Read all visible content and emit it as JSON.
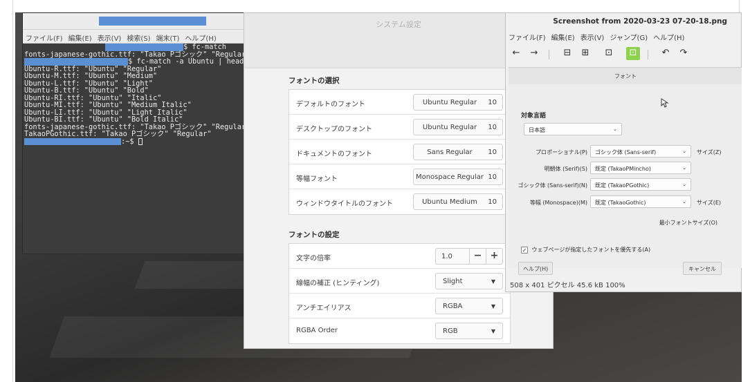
{
  "terminal": {
    "menu": [
      "ファイル(F)",
      "編集(E)",
      "表示(V)",
      "検索(S)",
      "端末(T)",
      "ヘルプ(H)"
    ],
    "window_buttons": [
      "–",
      "⤢",
      "⊗"
    ],
    "lines": [
      {
        "text": "$ fc-match",
        "prompt_width": 150,
        "indent": 117
      },
      {
        "text": "fonts-japanese-gothic.ttf: \"Takao Pゴシック\" \"Regular\"",
        "prompt_width": 0,
        "indent": 0
      },
      {
        "text": "$ fc-match -a Ubuntu | head",
        "prompt_width": 150,
        "indent": 0
      },
      {
        "text": "Ubuntu-R.ttf: \"Ubuntu\" \"Regular\"",
        "prompt_width": 0,
        "indent": 0
      },
      {
        "text": "Ubuntu-M.ttf: \"Ubuntu\" \"Medium\"",
        "prompt_width": 0,
        "indent": 0
      },
      {
        "text": "Ubuntu-L.ttf: \"Ubuntu\" \"Light\"",
        "prompt_width": 0,
        "indent": 0
      },
      {
        "text": "Ubuntu-B.ttf: \"Ubuntu\" \"Bold\"",
        "prompt_width": 0,
        "indent": 0
      },
      {
        "text": "Ubuntu-RI.ttf: \"Ubuntu\" \"Italic\"",
        "prompt_width": 0,
        "indent": 0
      },
      {
        "text": "Ubuntu-MI.ttf: \"Ubuntu\" \"Medium Italic\"",
        "prompt_width": 0,
        "indent": 0
      },
      {
        "text": "Ubuntu-LI.ttf: \"Ubuntu\" \"Light Italic\"",
        "prompt_width": 0,
        "indent": 0
      },
      {
        "text": "Ubuntu-BI.ttf: \"Ubuntu\" \"Bold Italic\"",
        "prompt_width": 0,
        "indent": 0
      },
      {
        "text": "fonts-japanese-gothic.ttf: \"Takao Pゴシック\" \"Regular\"",
        "prompt_width": 0,
        "indent": 0
      },
      {
        "text": "TakaoPGothic.ttf: \"Takao Pゴシック\" \"Regular\"",
        "prompt_width": 0,
        "indent": 0
      },
      {
        "text": ":~$ ",
        "prompt_width": 140,
        "indent": 0,
        "cursor": true
      }
    ]
  },
  "settings": {
    "title": "システム設定",
    "selection": {
      "title": "フォントの選択",
      "rows": [
        {
          "label": "デフォルトのフォント",
          "font": "Ubuntu Regular",
          "size": "10"
        },
        {
          "label": "デスクトップのフォント",
          "font": "Ubuntu Regular",
          "size": "10"
        },
        {
          "label": "ドキュメントのフォント",
          "font": "Sans Regular",
          "size": "10"
        },
        {
          "label": "等幅フォント",
          "font": "Monospace Regular",
          "size": "10"
        },
        {
          "label": "ウィンドウタイトルのフォント",
          "font": "Ubuntu Medium",
          "size": "10"
        }
      ]
    },
    "config": {
      "title": "フォントの設定",
      "scale_label": "文字の倍率",
      "scale_value": "1.0",
      "minus": "−",
      "plus": "+",
      "hinting_label": "線幅の補正 (ヒンティング)",
      "hinting_value": "Slight",
      "antialias_label": "アンチエイリアス",
      "antialias_value": "RGBA",
      "order_label": "RGBA Order",
      "order_value": "RGB",
      "arrow": "▼"
    }
  },
  "viewer": {
    "title": "Screenshot from 2020-03-23 07-20-18.png",
    "menu": [
      "ファイル(F)",
      "編集(E)",
      "表示(V)",
      "ジャンプ(G)",
      "ヘルプ(H)"
    ],
    "toolbar_icons": [
      "←",
      "→",
      "⊟",
      "⊞",
      "⊡",
      "⊡",
      "↶",
      "↷"
    ],
    "status": "508 x 401 ピクセル  45.6 kB  100%",
    "image": {
      "header": "フォント",
      "lang_title": "対象言語",
      "lang_value": "日本語",
      "rows": [
        {
          "label": "プロポーショナル(P)",
          "value": "ゴシック体 (Sans-serif)",
          "size_label": "サイズ(Z)"
        },
        {
          "label": "明朝体 (Serif)(S)",
          "value": "既定 (TakaoPMincho)",
          "size_label": ""
        },
        {
          "label": "ゴシック体 (Sans-serif)(N)",
          "value": "既定 (TakaoPGothic)",
          "size_label": ""
        },
        {
          "label": "等幅 (Monospace)(M)",
          "value": "既定 (TakaoGothic)",
          "size_label": "サイズ(E)"
        }
      ],
      "min_size": "最小フォントサイズ(O)",
      "checkbox": "ウェブページが指定したフォントを優先する(A)",
      "help": "ヘルプ(H)",
      "cancel": "キャンセル"
    }
  }
}
